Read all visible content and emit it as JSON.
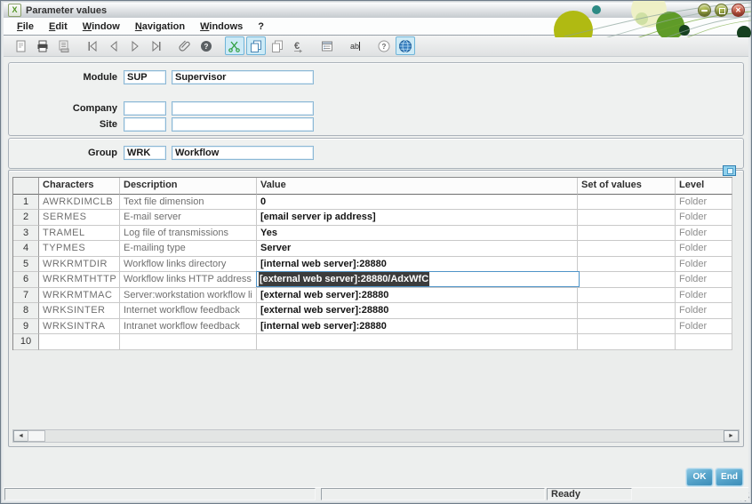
{
  "window": {
    "title": "Parameter values"
  },
  "menu": {
    "items": [
      {
        "label": "File"
      },
      {
        "label": "Edit"
      },
      {
        "label": "Window"
      },
      {
        "label": "Navigation"
      },
      {
        "label": "Windows"
      },
      {
        "label": "?"
      }
    ]
  },
  "toolbar": {
    "buttons": [
      {
        "name": "new-record",
        "active": false
      },
      {
        "name": "print",
        "active": false
      },
      {
        "name": "print-list",
        "active": false
      },
      {
        "name": "first-record",
        "active": false
      },
      {
        "name": "previous-record",
        "active": false
      },
      {
        "name": "next-record",
        "active": false
      },
      {
        "name": "last-record",
        "active": false
      },
      {
        "name": "attachment",
        "active": false
      },
      {
        "name": "context-help",
        "active": false
      },
      {
        "name": "cut",
        "active": true
      },
      {
        "name": "copy",
        "active": true
      },
      {
        "name": "paste",
        "active": false
      },
      {
        "name": "currency",
        "active": false
      },
      {
        "name": "properties",
        "active": false
      },
      {
        "name": "text-edit",
        "active": false
      },
      {
        "name": "help",
        "active": false
      },
      {
        "name": "web",
        "active": true
      }
    ]
  },
  "form": {
    "module": {
      "label": "Module",
      "code": "SUP",
      "description": "Supervisor"
    },
    "company": {
      "label": "Company",
      "code": "",
      "description": ""
    },
    "site": {
      "label": "Site",
      "code": "",
      "description": ""
    },
    "group": {
      "label": "Group",
      "code": "WRK",
      "description": "Workflow"
    }
  },
  "table": {
    "columns": [
      "",
      "Characters",
      "Description",
      "Value",
      "Set of values",
      "Level"
    ],
    "rows": [
      {
        "num": "1",
        "characters": "AWRKDIMCLB",
        "description": "Text file dimension",
        "value": "0",
        "set_of_values": "",
        "level": "Folder",
        "selected": false
      },
      {
        "num": "2",
        "characters": "SERMES",
        "description": "E-mail server",
        "value": "[email server ip address]",
        "set_of_values": "",
        "level": "Folder",
        "selected": false
      },
      {
        "num": "3",
        "characters": "TRAMEL",
        "description": "Log file of transmissions",
        "value": "Yes",
        "set_of_values": "",
        "level": "Folder",
        "selected": false
      },
      {
        "num": "4",
        "characters": "TYPMES",
        "description": "E-mailing type",
        "value": "Server",
        "set_of_values": "",
        "level": "Folder",
        "selected": false
      },
      {
        "num": "5",
        "characters": "WRKRMTDIR",
        "description": "Workflow links directory",
        "value": "[internal web server]:28880",
        "set_of_values": "",
        "level": "Folder",
        "selected": false
      },
      {
        "num": "6",
        "characters": "WRKRMTHTTP",
        "description": "Workflow links HTTP address",
        "value": "[external web server]:28880/AdxWfC",
        "set_of_values": "",
        "level": "Folder",
        "selected": true
      },
      {
        "num": "7",
        "characters": "WRKRMTMAC",
        "description": "Server:workstation workflow li",
        "value": "[external web server]:28880",
        "set_of_values": "",
        "level": "Folder",
        "selected": false
      },
      {
        "num": "8",
        "characters": "WRKSINTER",
        "description": "Internet workflow feedback",
        "value": "[external web server]:28880",
        "set_of_values": "",
        "level": "Folder",
        "selected": false
      },
      {
        "num": "9",
        "characters": "WRKSINTRA",
        "description": "Intranet workflow feedback",
        "value": "[internal web server]:28880",
        "set_of_values": "",
        "level": "Folder",
        "selected": false
      },
      {
        "num": "10",
        "characters": "",
        "description": "",
        "value": "",
        "set_of_values": "",
        "level": "",
        "selected": false
      }
    ]
  },
  "buttons": {
    "ok": "OK",
    "end": "End"
  },
  "status": {
    "ready": "Ready"
  },
  "colors": {
    "accent_blue": "#3f8fba",
    "selection_bg": "#3c3c3c",
    "active_tool_bg": "#cdeaf6",
    "field_border": "#8cb8d6",
    "olive": "#b0ba12",
    "green": "#5f9b28",
    "dark_green": "#16401f",
    "pale_yellow": "#eef0c6",
    "close_red": "#b23a28"
  }
}
